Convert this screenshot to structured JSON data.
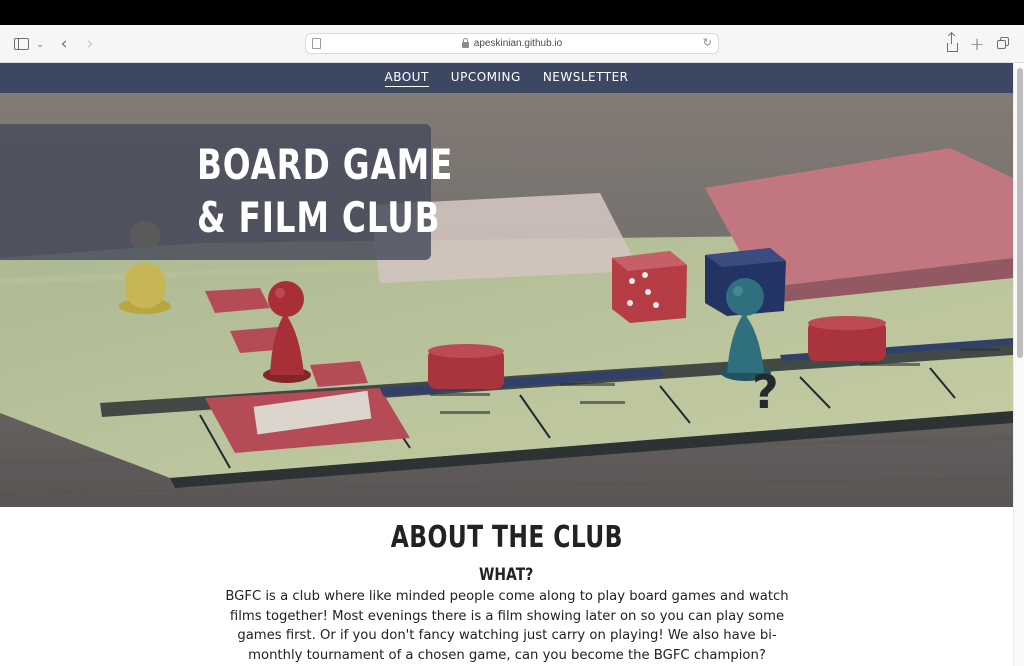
{
  "browser": {
    "url": "apeskinian.github.io"
  },
  "nav": {
    "items": [
      {
        "label": "ABOUT",
        "active": true
      },
      {
        "label": "UPCOMING",
        "active": false
      },
      {
        "label": "NEWSLETTER",
        "active": false
      }
    ]
  },
  "hero": {
    "title_line1": "BOARD GAME",
    "title_line2": "& FILM CLUB"
  },
  "about": {
    "heading": "ABOUT THE CLUB",
    "subheading": "WHAT?",
    "body": "BGFC is a club where like minded people come along to play board games and watch films together! Most evenings there is a film showing later on so you can play some games first. Or if you don't fancy watching just carry on playing! We also have bi-monthly tournament of a chosen game, can you become the BGFC champion?"
  },
  "colors": {
    "nav_bg": "#3c4863",
    "title_panel": "#474a5c"
  },
  "icons": [
    "sidebar-icon",
    "chevron-down-icon",
    "back-icon",
    "forward-icon",
    "page-icon",
    "lock-icon",
    "reload-icon",
    "share-icon",
    "plus-icon",
    "tabs-icon"
  ]
}
